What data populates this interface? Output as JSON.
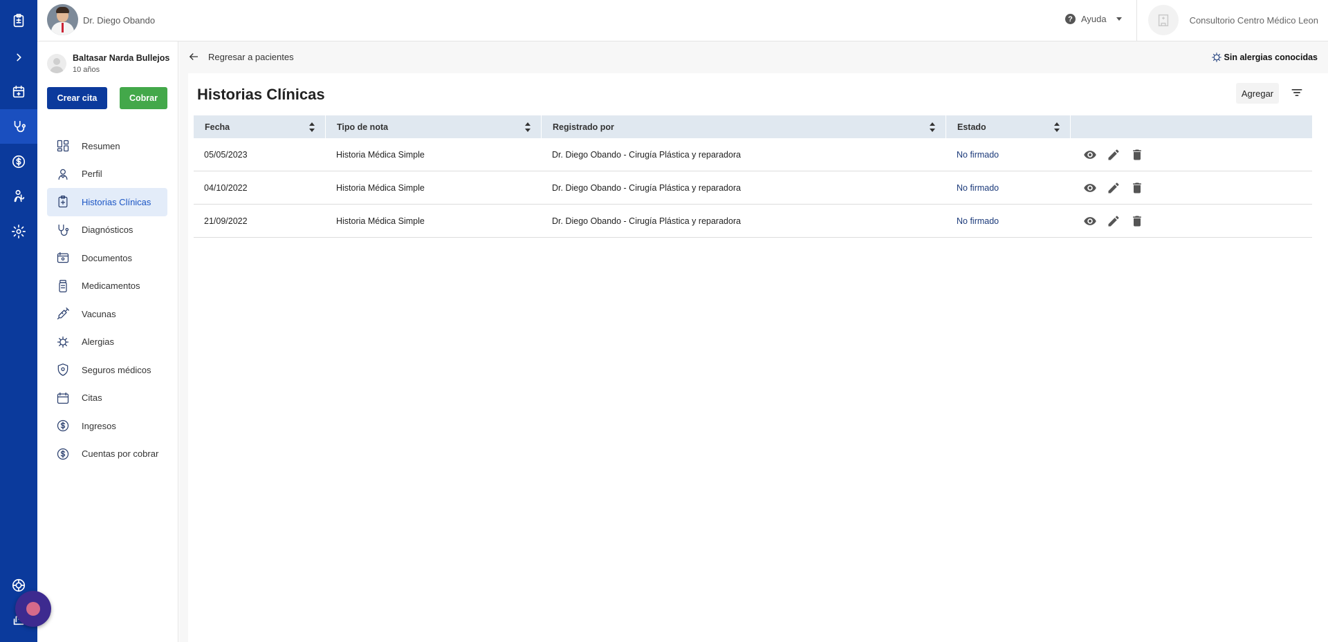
{
  "header": {
    "doctor_name": "Dr. Diego Obando",
    "help_label": "Ayuda",
    "clinic_name": "Consultorio Centro Médico Leon"
  },
  "rail": {
    "items": [
      "clipboard-icon",
      "chevron-right-icon",
      "calendar-icon",
      "patients-icon",
      "dollar-icon",
      "doctor-icon",
      "settings-icon",
      "support-icon",
      "logout-icon"
    ],
    "active": "patients-icon",
    "color": "#0b3a9c"
  },
  "patient": {
    "name": "Baltasar Narda Bullejos",
    "age": "10 años",
    "create_button": "Crear cita",
    "charge_button": "Cobrar"
  },
  "nav": {
    "items": [
      {
        "label": "Resumen",
        "icon": "dashboard-icon"
      },
      {
        "label": "Perfil",
        "icon": "profile-icon"
      },
      {
        "label": "Historias Clínicas",
        "icon": "medical-record-icon"
      },
      {
        "label": "Diagnósticos",
        "icon": "stethoscope-icon"
      },
      {
        "label": "Documentos",
        "icon": "document-icon"
      },
      {
        "label": "Medicamentos",
        "icon": "medication-icon"
      },
      {
        "label": "Vacunas",
        "icon": "syringe-icon"
      },
      {
        "label": "Alergias",
        "icon": "allergy-icon"
      },
      {
        "label": "Seguros médicos",
        "icon": "shield-icon"
      },
      {
        "label": "Citas",
        "icon": "calendar-icon"
      },
      {
        "label": "Ingresos",
        "icon": "dollar-icon"
      },
      {
        "label": "Cuentas por cobrar",
        "icon": "dollar-icon"
      }
    ],
    "active_index": 2
  },
  "main": {
    "back_label": "Regresar a pacientes",
    "allergy_label": "Sin alergias conocidas",
    "title": "Historias Clínicas",
    "add_button": "Agregar"
  },
  "table": {
    "columns": [
      "Fecha",
      "Tipo de nota",
      "Registrado por",
      "Estado"
    ],
    "rows": [
      {
        "fecha": "05/05/2023",
        "tipo": "Historia Médica Simple",
        "registrado": "Dr. Diego Obando - Cirugía Plástica y reparadora",
        "estado": "No firmado"
      },
      {
        "fecha": "04/10/2022",
        "tipo": "Historia Médica Simple",
        "registrado": "Dr. Diego Obando - Cirugía Plástica y reparadora",
        "estado": "No firmado"
      },
      {
        "fecha": "21/09/2022",
        "tipo": "Historia Médica Simple",
        "registrado": "Dr. Diego Obando - Cirugía Plástica y reparadora",
        "estado": "No firmado"
      }
    ],
    "row_actions": [
      "view-icon",
      "edit-icon",
      "delete-icon"
    ]
  }
}
